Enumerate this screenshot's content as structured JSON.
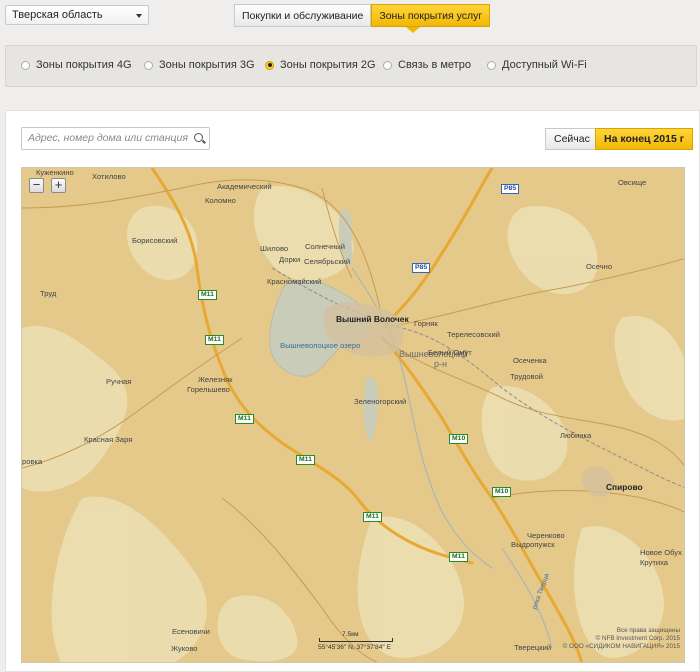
{
  "region": {
    "label": "Тверская область"
  },
  "tabs": [
    {
      "label": "Покупки и обслуживание",
      "active": false
    },
    {
      "label": "Зоны покрытия услуг",
      "active": true
    }
  ],
  "coverage_options": [
    {
      "label": "Зоны покрытия 4G",
      "selected": false
    },
    {
      "label": "Зоны покрытия 3G",
      "selected": false
    },
    {
      "label": "Зоны покрытия 2G",
      "selected": true
    },
    {
      "label": "Связь в метро",
      "selected": false
    },
    {
      "label": "Доступный Wi-Fi",
      "selected": false
    }
  ],
  "search": {
    "placeholder": "Адрес, номер дома или станция"
  },
  "period": {
    "now_label": "Сейчас",
    "future_label": "На конец 2015 г"
  },
  "map": {
    "zoom_out": "−",
    "zoom_in": "+",
    "places": {
      "kuzhenkino": "Куженкино",
      "khotilovo": "Хотилово",
      "akademichesky": "Академический",
      "kolomno": "Коломно",
      "borisovsky": "Борисовский",
      "shilovo": "Шилово",
      "dorki": "Дорки",
      "solnechny": "Солнечный",
      "selyavrovsky": "Селябрьский",
      "krasnomaysky": "Красномайский",
      "trud": "Труд",
      "vyshny_volochek": "Вышний Волочек",
      "goryak": "Горняк",
      "vyshnevolotsky_ozero": "Вышневолоцкое озеро",
      "vyshnevolotsky_rn_1": "Вышневолоцкий",
      "vyshnevolotsky_rn_2": "р-н",
      "bely_omut": "Белый Омут",
      "tereleshevsky": "Терелесовский",
      "osechenka": "Осеченка",
      "trudovoy": "Трудовой",
      "ruchnaya": "Ручная",
      "zheleznyak": "Железняк",
      "gorelshevo": "Горельшево",
      "zelenogorsky": "Зеленогорский",
      "krasnaya_zarya": "Красная Заря",
      "lyubinka": "Любинка",
      "osechno": "Осечно",
      "ovsishche": "Овсище",
      "spirovo": "Спирово",
      "chernkovo": "Черенково",
      "vydropuzhsk": "Выдропужск",
      "novoe_ogarkovo_1": "Новое Обух",
      "novoe_ogarkovo_2": "Крутиха",
      "esenovichi": "Есеновичи",
      "zhukovo": "Жуково",
      "tveretsky": "Тверецкий",
      "rovka": "ровка",
      "reka_tvertsa": "река Тверца"
    },
    "roads": {
      "m11": "M11",
      "m10": "M10",
      "r85": "P85"
    },
    "scale": "7.5км",
    "coords": "55°45'36\" N, 37°37'84\" E",
    "copyright": [
      "Все права защищены",
      "© NFB Investment Corp. 2015",
      "© ООО «СИДИКОМ НАВИГАЦИЯ» 2015"
    ]
  }
}
